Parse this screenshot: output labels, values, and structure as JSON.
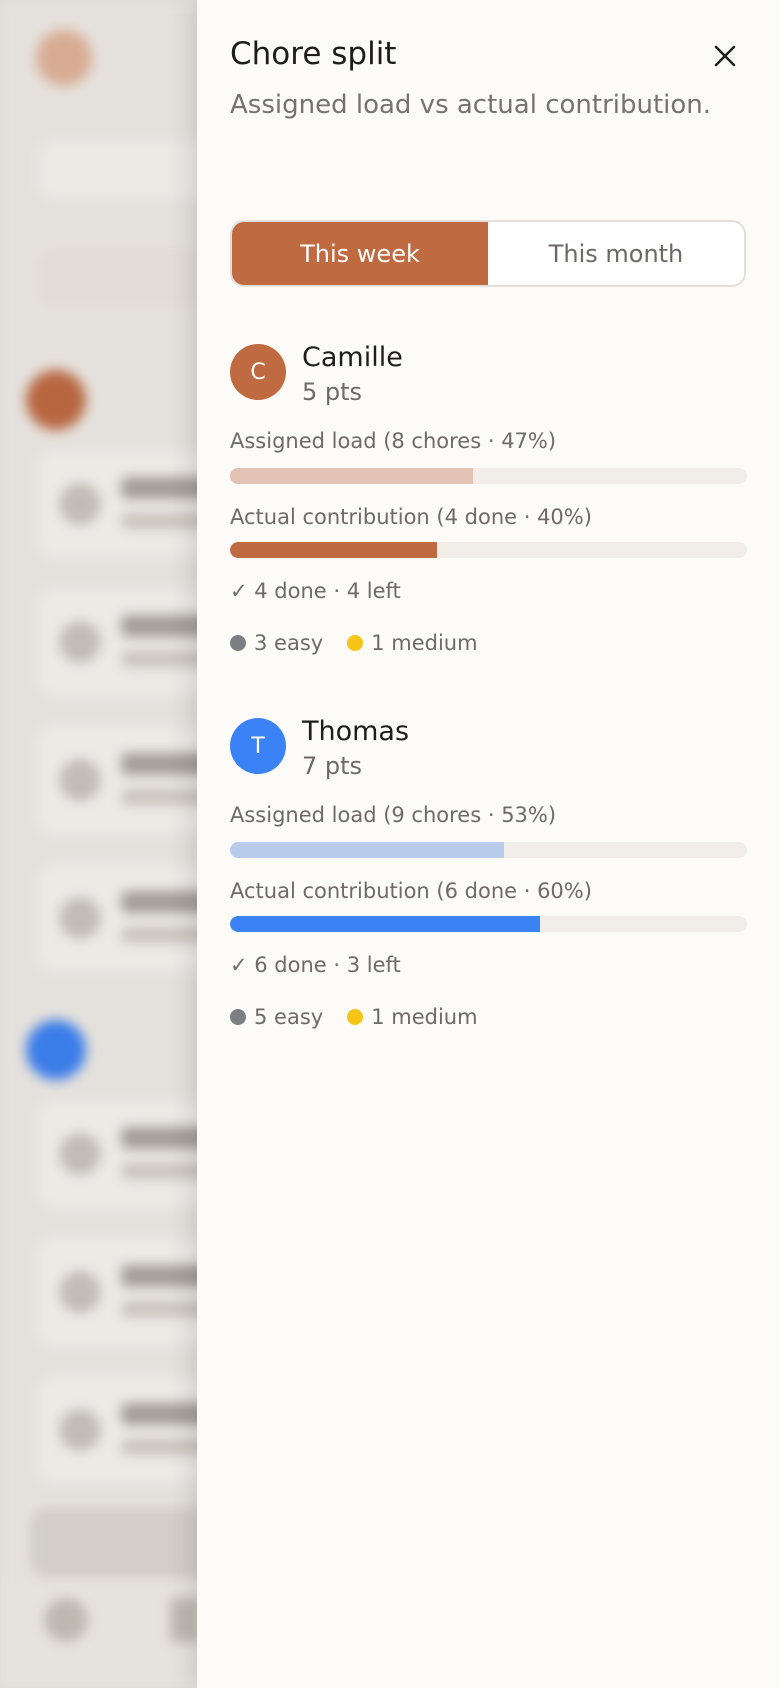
{
  "sheet": {
    "title": "Chore split",
    "subtitle": "Assigned load vs actual contribution.",
    "close_icon": "close-icon",
    "tabs": [
      {
        "label": "This week",
        "active": true
      },
      {
        "label": "This month",
        "active": false
      }
    ]
  },
  "colors": {
    "accent": "#c06a42",
    "easy": "#7b7f84",
    "medium": "#f5c518",
    "camille": "#c06a42",
    "camille_light": "#e3c2b4",
    "thomas": "#3b82f6",
    "thomas_light": "#b8cbeb"
  },
  "people": [
    {
      "initial": "C",
      "name": "Camille",
      "points": "5 pts",
      "assigned_label": "Assigned load (8 chores · 47%)",
      "assigned_fraction": 0.47,
      "actual_label": "Actual contribution (4 done · 40%)",
      "actual_fraction": 0.4,
      "done_summary": "✓ 4 done · 4 left",
      "easy": "3 easy",
      "medium": "1 medium"
    },
    {
      "initial": "T",
      "name": "Thomas",
      "points": "7 pts",
      "assigned_label": "Assigned load (9 chores · 53%)",
      "assigned_fraction": 0.53,
      "actual_label": "Actual contribution (6 done · 60%)",
      "actual_fraction": 0.6,
      "done_summary": "✓ 6 done · 3 left",
      "easy": "5 easy",
      "medium": "1 medium"
    }
  ]
}
